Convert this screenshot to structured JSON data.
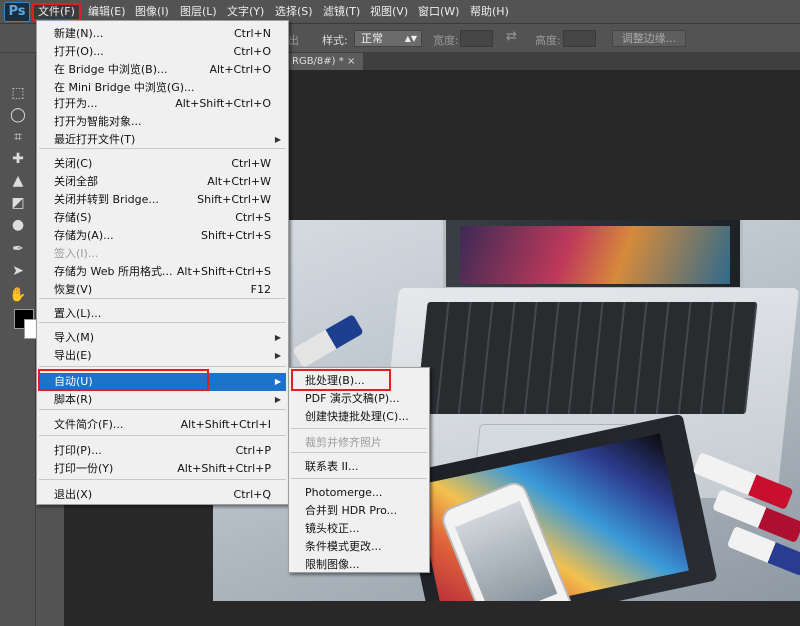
{
  "app": {
    "logo": "Ps"
  },
  "menubar": {
    "items": [
      "文件(F)",
      "编辑(E)",
      "图像(I)",
      "图层(L)",
      "文字(Y)",
      "选择(S)",
      "滤镜(T)",
      "视图(V)",
      "窗口(W)",
      "帮助(H)"
    ]
  },
  "options": {
    "partial_left": "出",
    "style_label": "样式:",
    "style_value": "正常",
    "width_label": "宽度:",
    "height_label": "高度:",
    "refine_edge": "调整边缘..."
  },
  "document": {
    "tab_title": "RGB/8#) *",
    "close": "×"
  },
  "file_menu": {
    "items": [
      {
        "label": "新建(N)...",
        "shortcut": "Ctrl+N"
      },
      {
        "label": "打开(O)...",
        "shortcut": "Ctrl+O"
      },
      {
        "label": "在 Bridge 中浏览(B)...",
        "shortcut": "Alt+Ctrl+O"
      },
      {
        "label": "在 Mini Bridge 中浏览(G)...",
        "shortcut": ""
      },
      {
        "label": "打开为...",
        "shortcut": "Alt+Shift+Ctrl+O"
      },
      {
        "label": "打开为智能对象...",
        "shortcut": ""
      },
      {
        "label": "最近打开文件(T)",
        "shortcut": ""
      },
      {
        "label": "关闭(C)",
        "shortcut": "Ctrl+W"
      },
      {
        "label": "关闭全部",
        "shortcut": "Alt+Ctrl+W"
      },
      {
        "label": "关闭并转到 Bridge...",
        "shortcut": "Shift+Ctrl+W"
      },
      {
        "label": "存储(S)",
        "shortcut": "Ctrl+S"
      },
      {
        "label": "存储为(A)...",
        "shortcut": "Shift+Ctrl+S"
      },
      {
        "label": "签入(I)...",
        "shortcut": ""
      },
      {
        "label": "存储为 Web 所用格式...",
        "shortcut": "Alt+Shift+Ctrl+S"
      },
      {
        "label": "恢复(V)",
        "shortcut": "F12"
      },
      {
        "label": "置入(L)...",
        "shortcut": ""
      },
      {
        "label": "导入(M)",
        "shortcut": ""
      },
      {
        "label": "导出(E)",
        "shortcut": ""
      },
      {
        "label": "自动(U)",
        "shortcut": ""
      },
      {
        "label": "脚本(R)",
        "shortcut": ""
      },
      {
        "label": "文件简介(F)...",
        "shortcut": "Alt+Shift+Ctrl+I"
      },
      {
        "label": "打印(P)...",
        "shortcut": "Ctrl+P"
      },
      {
        "label": "打印一份(Y)",
        "shortcut": "Alt+Shift+Ctrl+P"
      },
      {
        "label": "退出(X)",
        "shortcut": "Ctrl+Q"
      }
    ],
    "submenu_arrow": "▶"
  },
  "automate_submenu": {
    "items": [
      "批处理(B)...",
      "PDF 演示文稿(P)...",
      "创建快捷批处理(C)...",
      "裁剪并修齐照片",
      "联系表 II...",
      "Photomerge...",
      "合并到 HDR Pro...",
      "镜头校正...",
      "条件模式更改...",
      "限制图像..."
    ]
  },
  "toolbar": {
    "icons": [
      "marquee-icon",
      "lasso-icon",
      "crop-icon",
      "healing-icon",
      "stamp-icon",
      "eraser-icon",
      "blur-icon",
      "pen-icon",
      "path-select-icon",
      "hand-icon"
    ],
    "glyphs": [
      "⬚",
      "◯",
      "⌗",
      "✚",
      "▲",
      "◩",
      "●",
      "✒",
      "➤",
      "✋"
    ]
  }
}
